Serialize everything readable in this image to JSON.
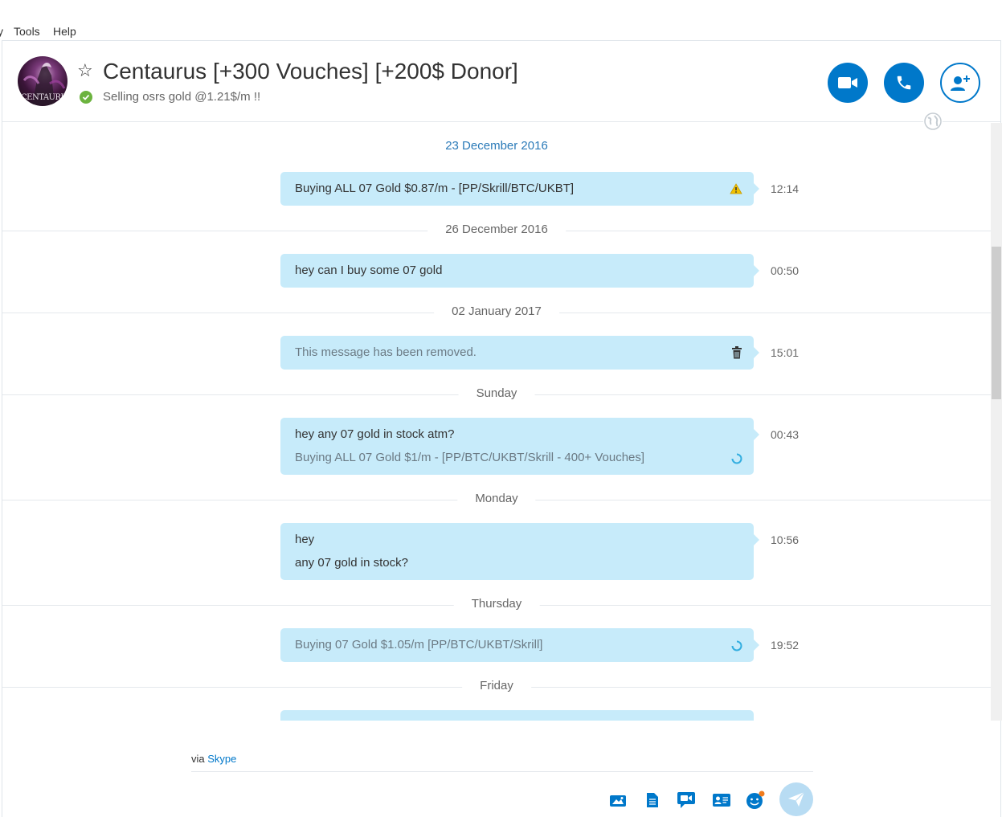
{
  "menu": {
    "partial": "y",
    "tools": "Tools",
    "help": "Help"
  },
  "header": {
    "title": "Centaurus [+300 Vouches] [+200$ Donor]",
    "mood": "Selling osrs gold @1.21$/m !!",
    "avatar_text": "CENTAURUS",
    "video_icon": "video-call-icon",
    "call_icon": "phone-call-icon",
    "add_icon": "add-contact-icon"
  },
  "conversation": {
    "dates": [
      "23 December 2016",
      "26 December 2016",
      "02 January 2017",
      "Sunday",
      "Monday",
      "Thursday",
      "Friday"
    ],
    "messages": [
      {
        "lines": [
          "Buying ALL 07 Gold $0.87/m - [PP/Skrill/BTC/UKBT]"
        ],
        "time": "12:14",
        "indicator": "warning-icon"
      },
      {
        "lines": [
          "hey can I buy some 07 gold"
        ],
        "time": "00:50"
      },
      {
        "lines": [
          "This message has been removed."
        ],
        "time": "15:01",
        "indicator": "trash-icon"
      },
      {
        "lines": [
          "hey any 07 gold in stock atm?",
          "Buying ALL 07 Gold $1/m - [PP/BTC/UKBT/Skrill - 400+ Vouches]"
        ],
        "time": "00:43",
        "indicator": "sending-spinner-icon"
      },
      {
        "lines": [
          "hey",
          "any 07 gold in stock?"
        ],
        "time": "10:56"
      },
      {
        "lines": [
          "Buying 07 Gold $1.05/m [PP/BTC/UKBT/Skrill]"
        ],
        "time": "19:52",
        "indicator": "sending-spinner-icon"
      }
    ]
  },
  "composer": {
    "via": "via",
    "via_link": "Skype"
  },
  "colors": {
    "accent": "#0078ca",
    "bubble": "#c7ebfa",
    "online": "#6cb33f"
  }
}
